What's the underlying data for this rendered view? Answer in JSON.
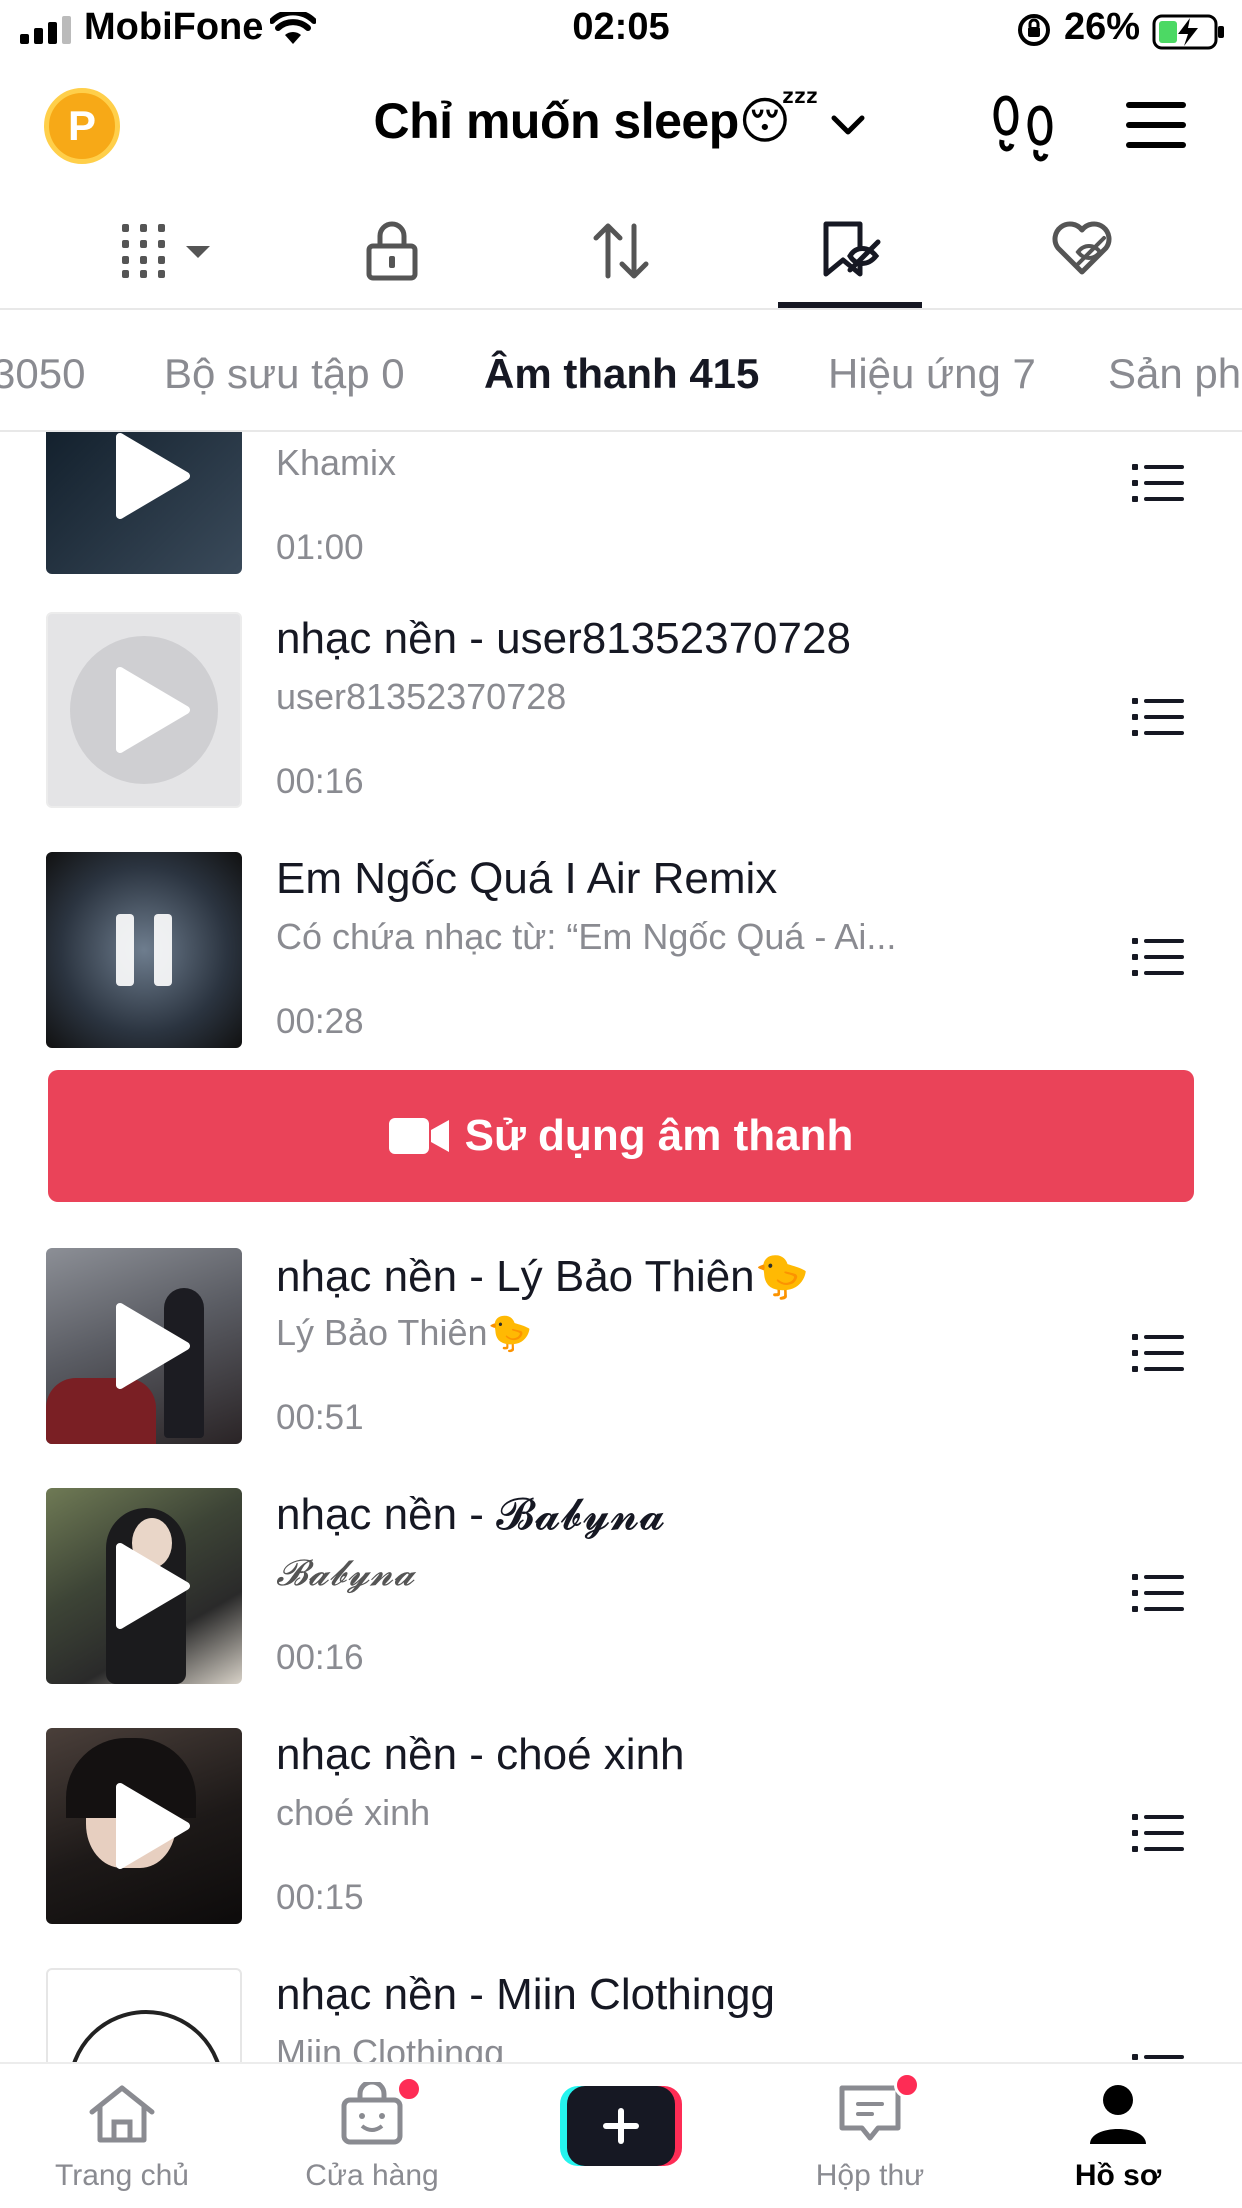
{
  "status_bar": {
    "carrier": "MobiFone",
    "time": "02:05",
    "battery": "26%"
  },
  "header": {
    "coin_letter": "P",
    "profile_name": "Chỉ muốn sleep😴"
  },
  "content_tabs": [
    "filter-icon",
    "lock-icon",
    "repost-icon",
    "favorites-icon",
    "liked-icon"
  ],
  "categories": [
    {
      "label": "3050"
    },
    {
      "label": "Bộ sưu tập 0"
    },
    {
      "label": "Âm thanh 415"
    },
    {
      "label": "Hiệu ứng 7"
    },
    {
      "label": "Sản ph"
    }
  ],
  "sounds": [
    {
      "title": "",
      "author": "Khamix",
      "duration": "01:00"
    },
    {
      "title": "nhạc nền - user81352370728",
      "author": "user81352370728",
      "duration": "00:16"
    },
    {
      "title": "Em Ngốc Quá I Air Remix",
      "author": "Có chứa nhạc từ: “Em Ngốc Quá - Ai...",
      "duration": "00:28"
    },
    {
      "title": "nhạc nền - Lý Bảo Thiên🐤",
      "author": "Lý Bảo Thiên🐤",
      "duration": "00:51"
    },
    {
      "title": "nhạc nền - 𝓑𝓪𝓫𝔂𝓷𝓪",
      "author": "𝓑𝓪𝓫𝔂𝓷𝓪",
      "duration": "00:16"
    },
    {
      "title": "nhạc nền - choé xinh",
      "author": "choé xinh",
      "duration": "00:15"
    },
    {
      "title": "nhạc nền - Miin Clothingg",
      "author": "Miin Clothingg",
      "duration": ""
    }
  ],
  "use_sound_button": "Sử dụng âm thanh",
  "bottom_nav": {
    "home": "Trang chủ",
    "shop": "Cửa hàng",
    "inbox": "Hộp thư",
    "profile": "Hồ sơ"
  },
  "colors": {
    "accent": "#ea4359",
    "badge": "#fe2c55",
    "text": "#161823",
    "muted": "#8a8b91"
  }
}
